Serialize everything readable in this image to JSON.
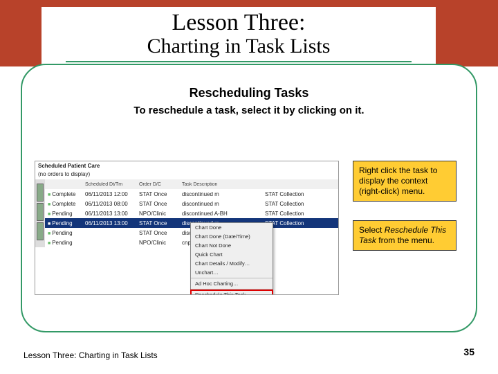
{
  "title": {
    "line1": "Lesson Three:",
    "line2": "Charting in Task Lists"
  },
  "sub": {
    "heading": "Rescheduling Tasks",
    "instruction": "To reschedule a task, select it by clicking on it."
  },
  "callout1": {
    "text": "Right click the task to display the context (right-click) menu."
  },
  "callout2": {
    "prefix": "Select ",
    "italic": "Reschedule This Task",
    "suffix": " from the menu."
  },
  "app": {
    "window_title": "Scheduled Patient Care",
    "section": "(no orders to display)",
    "headers": {
      "a": "",
      "b": "Scheduled Dt/Tm",
      "c": "Order D/C",
      "d": "Task Description",
      "e": ""
    },
    "rows": [
      {
        "a": "Complete",
        "b": "06/11/2013  12:00",
        "c": "STAT Once",
        "d": "discontinued m",
        "e": "STAT Collection",
        "selected": false
      },
      {
        "a": "Complete",
        "b": "06/11/2013  08:00",
        "c": "STAT Once",
        "d": "discontinued m",
        "e": "STAT Collection",
        "selected": false
      },
      {
        "a": "Pending",
        "b": "06/11/2013  13:00",
        "c": "NPO/Clinic",
        "d": "discontinued A-BH",
        "e": "STAT Collection",
        "selected": false
      },
      {
        "a": "Pending",
        "b": "06/11/2013  13:00",
        "c": "STAT Once",
        "d": "discontinued m",
        "e": "STAT Collection",
        "selected": true
      },
      {
        "a": "Pending",
        "b": "",
        "c": "STAT Once",
        "d": "discontinued m",
        "e": "",
        "selected": false
      },
      {
        "a": "Pending",
        "b": "",
        "c": "NPO/Clinic",
        "d": "cnp; showed ws, PPN fed mg",
        "e": "",
        "selected": false
      }
    ],
    "context_menu": [
      {
        "label": "Chart Done",
        "sep_after": false
      },
      {
        "label": "Chart Done (Date/Time)",
        "sep_after": false
      },
      {
        "label": "Chart Not Done",
        "sep_after": false
      },
      {
        "label": "Quick Chart",
        "sep_after": false
      },
      {
        "label": "Chart Details / Modify…",
        "sep_after": false
      },
      {
        "label": "Unchart…",
        "sep_after": true
      },
      {
        "label": "Ad Hoc Charting…",
        "sep_after": true
      },
      {
        "label": "Reschedule This Task…",
        "sep_after": false,
        "highlight": true
      }
    ]
  },
  "footer": {
    "left": "Lesson Three: Charting in Task Lists",
    "page": "35"
  }
}
